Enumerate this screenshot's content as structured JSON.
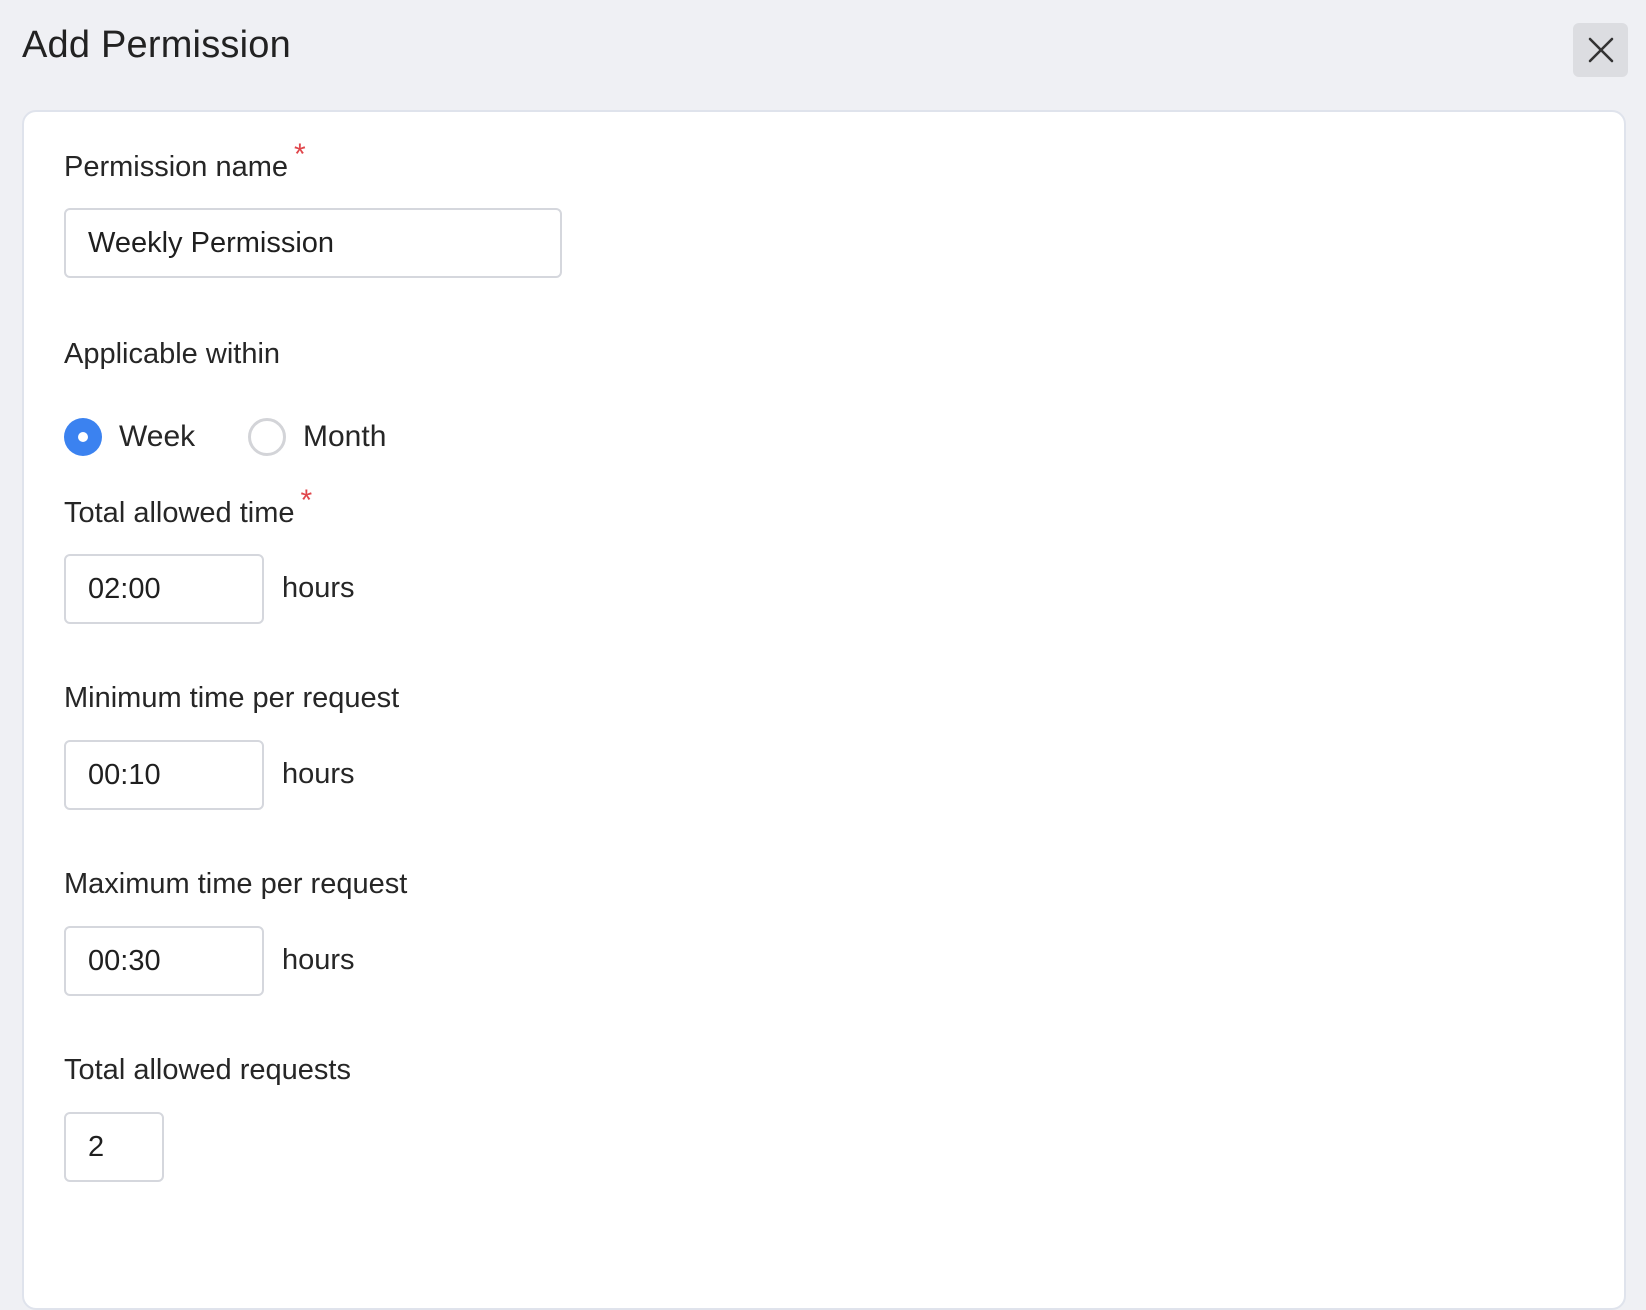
{
  "header": {
    "title": "Add Permission",
    "close_icon": "close-icon"
  },
  "form": {
    "permission_name": {
      "label": "Permission name",
      "required_mark": "*",
      "value": "Weekly Permission"
    },
    "applicable_within": {
      "label": "Applicable within",
      "options": [
        {
          "label": "Week",
          "selected": true
        },
        {
          "label": "Month",
          "selected": false
        }
      ]
    },
    "total_allowed_time": {
      "label": "Total allowed time",
      "required_mark": "*",
      "value": "02:00",
      "unit": "hours"
    },
    "minimum_time_per_request": {
      "label": "Minimum time per request",
      "value": "00:10",
      "unit": "hours"
    },
    "maximum_time_per_request": {
      "label": "Maximum time per request",
      "value": "00:30",
      "unit": "hours"
    },
    "total_allowed_requests": {
      "label": "Total allowed requests",
      "value": "2"
    }
  },
  "colors": {
    "accent": "#3b82f0",
    "required": "#e0464b",
    "page_background": "#eff0f4",
    "card_background": "#ffffff"
  }
}
